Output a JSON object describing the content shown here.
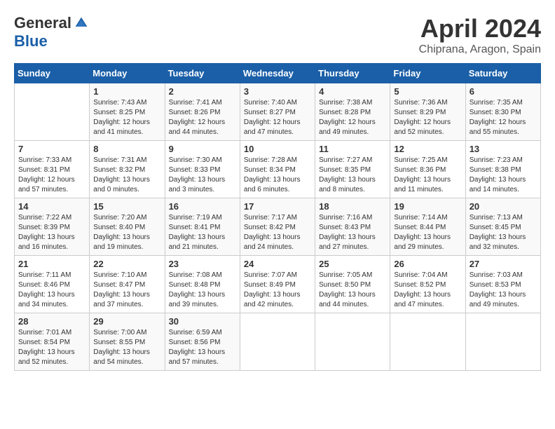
{
  "logo": {
    "general": "General",
    "blue": "Blue"
  },
  "title": "April 2024",
  "subtitle": "Chiprana, Aragon, Spain",
  "headers": [
    "Sunday",
    "Monday",
    "Tuesday",
    "Wednesday",
    "Thursday",
    "Friday",
    "Saturday"
  ],
  "rows": [
    [
      {
        "num": "",
        "info": ""
      },
      {
        "num": "1",
        "info": "Sunrise: 7:43 AM\nSunset: 8:25 PM\nDaylight: 12 hours\nand 41 minutes."
      },
      {
        "num": "2",
        "info": "Sunrise: 7:41 AM\nSunset: 8:26 PM\nDaylight: 12 hours\nand 44 minutes."
      },
      {
        "num": "3",
        "info": "Sunrise: 7:40 AM\nSunset: 8:27 PM\nDaylight: 12 hours\nand 47 minutes."
      },
      {
        "num": "4",
        "info": "Sunrise: 7:38 AM\nSunset: 8:28 PM\nDaylight: 12 hours\nand 49 minutes."
      },
      {
        "num": "5",
        "info": "Sunrise: 7:36 AM\nSunset: 8:29 PM\nDaylight: 12 hours\nand 52 minutes."
      },
      {
        "num": "6",
        "info": "Sunrise: 7:35 AM\nSunset: 8:30 PM\nDaylight: 12 hours\nand 55 minutes."
      }
    ],
    [
      {
        "num": "7",
        "info": "Sunrise: 7:33 AM\nSunset: 8:31 PM\nDaylight: 12 hours\nand 57 minutes."
      },
      {
        "num": "8",
        "info": "Sunrise: 7:31 AM\nSunset: 8:32 PM\nDaylight: 13 hours\nand 0 minutes."
      },
      {
        "num": "9",
        "info": "Sunrise: 7:30 AM\nSunset: 8:33 PM\nDaylight: 13 hours\nand 3 minutes."
      },
      {
        "num": "10",
        "info": "Sunrise: 7:28 AM\nSunset: 8:34 PM\nDaylight: 13 hours\nand 6 minutes."
      },
      {
        "num": "11",
        "info": "Sunrise: 7:27 AM\nSunset: 8:35 PM\nDaylight: 13 hours\nand 8 minutes."
      },
      {
        "num": "12",
        "info": "Sunrise: 7:25 AM\nSunset: 8:36 PM\nDaylight: 13 hours\nand 11 minutes."
      },
      {
        "num": "13",
        "info": "Sunrise: 7:23 AM\nSunset: 8:38 PM\nDaylight: 13 hours\nand 14 minutes."
      }
    ],
    [
      {
        "num": "14",
        "info": "Sunrise: 7:22 AM\nSunset: 8:39 PM\nDaylight: 13 hours\nand 16 minutes."
      },
      {
        "num": "15",
        "info": "Sunrise: 7:20 AM\nSunset: 8:40 PM\nDaylight: 13 hours\nand 19 minutes."
      },
      {
        "num": "16",
        "info": "Sunrise: 7:19 AM\nSunset: 8:41 PM\nDaylight: 13 hours\nand 21 minutes."
      },
      {
        "num": "17",
        "info": "Sunrise: 7:17 AM\nSunset: 8:42 PM\nDaylight: 13 hours\nand 24 minutes."
      },
      {
        "num": "18",
        "info": "Sunrise: 7:16 AM\nSunset: 8:43 PM\nDaylight: 13 hours\nand 27 minutes."
      },
      {
        "num": "19",
        "info": "Sunrise: 7:14 AM\nSunset: 8:44 PM\nDaylight: 13 hours\nand 29 minutes."
      },
      {
        "num": "20",
        "info": "Sunrise: 7:13 AM\nSunset: 8:45 PM\nDaylight: 13 hours\nand 32 minutes."
      }
    ],
    [
      {
        "num": "21",
        "info": "Sunrise: 7:11 AM\nSunset: 8:46 PM\nDaylight: 13 hours\nand 34 minutes."
      },
      {
        "num": "22",
        "info": "Sunrise: 7:10 AM\nSunset: 8:47 PM\nDaylight: 13 hours\nand 37 minutes."
      },
      {
        "num": "23",
        "info": "Sunrise: 7:08 AM\nSunset: 8:48 PM\nDaylight: 13 hours\nand 39 minutes."
      },
      {
        "num": "24",
        "info": "Sunrise: 7:07 AM\nSunset: 8:49 PM\nDaylight: 13 hours\nand 42 minutes."
      },
      {
        "num": "25",
        "info": "Sunrise: 7:05 AM\nSunset: 8:50 PM\nDaylight: 13 hours\nand 44 minutes."
      },
      {
        "num": "26",
        "info": "Sunrise: 7:04 AM\nSunset: 8:52 PM\nDaylight: 13 hours\nand 47 minutes."
      },
      {
        "num": "27",
        "info": "Sunrise: 7:03 AM\nSunset: 8:53 PM\nDaylight: 13 hours\nand 49 minutes."
      }
    ],
    [
      {
        "num": "28",
        "info": "Sunrise: 7:01 AM\nSunset: 8:54 PM\nDaylight: 13 hours\nand 52 minutes."
      },
      {
        "num": "29",
        "info": "Sunrise: 7:00 AM\nSunset: 8:55 PM\nDaylight: 13 hours\nand 54 minutes."
      },
      {
        "num": "30",
        "info": "Sunrise: 6:59 AM\nSunset: 8:56 PM\nDaylight: 13 hours\nand 57 minutes."
      },
      {
        "num": "",
        "info": ""
      },
      {
        "num": "",
        "info": ""
      },
      {
        "num": "",
        "info": ""
      },
      {
        "num": "",
        "info": ""
      }
    ]
  ]
}
